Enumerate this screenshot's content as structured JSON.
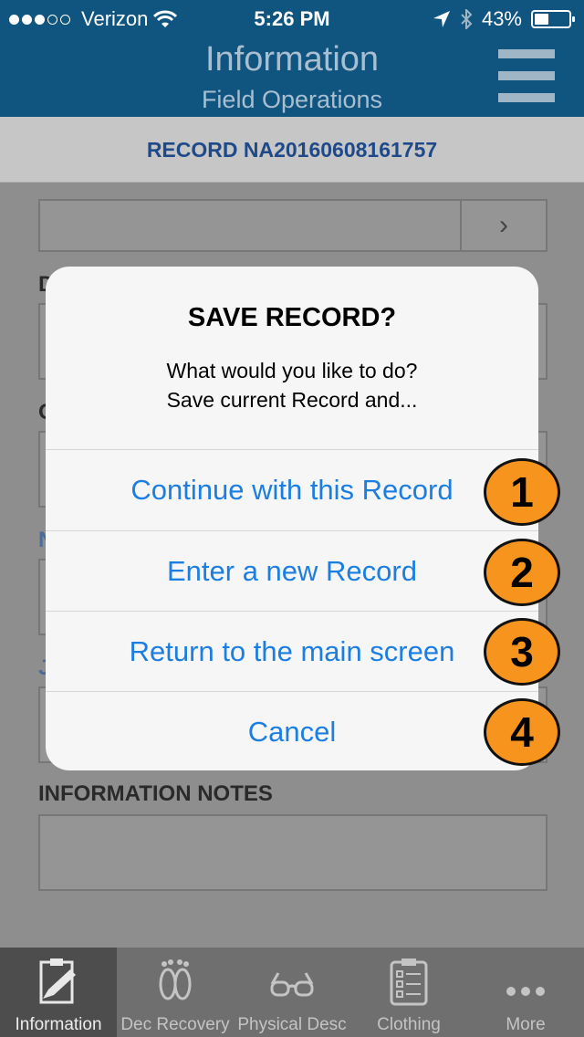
{
  "status_bar": {
    "carrier": "Verizon",
    "time": "5:26 PM",
    "battery_percent": "43%",
    "battery_level": 0.43,
    "signal_bars_filled": 3,
    "signal_bars_total": 5
  },
  "nav": {
    "title": "Information",
    "subtitle": "Field Operations"
  },
  "record": {
    "label": "RECORD NA20160608161757"
  },
  "form": {
    "label_d": "D",
    "label_o": "O",
    "label_n": "N",
    "label_j": "J",
    "notes_label": "INFORMATION NOTES"
  },
  "alert": {
    "title": "SAVE RECORD?",
    "message_line1": "What would you like to do?",
    "message_line2": "Save current Record and...",
    "buttons": [
      {
        "label": "Continue with this Record",
        "badge": "1"
      },
      {
        "label": "Enter a new Record",
        "badge": "2"
      },
      {
        "label": "Return to the main screen",
        "badge": "3"
      },
      {
        "label": "Cancel",
        "badge": "4"
      }
    ]
  },
  "tabs": [
    {
      "label": "Information",
      "icon": "clipboard-pencil-icon",
      "active": true
    },
    {
      "label": "Dec Recovery",
      "icon": "footprints-icon",
      "active": false
    },
    {
      "label": "Physical Desc",
      "icon": "glasses-icon",
      "active": false
    },
    {
      "label": "Clothing",
      "icon": "checklist-icon",
      "active": false
    },
    {
      "label": "More",
      "icon": "more-dots-icon",
      "active": false
    }
  ],
  "colors": {
    "nav_background": "#105480",
    "link_blue": "#1b7ee0",
    "badge_orange": "#f7941d",
    "record_text": "#1f4a8a"
  }
}
